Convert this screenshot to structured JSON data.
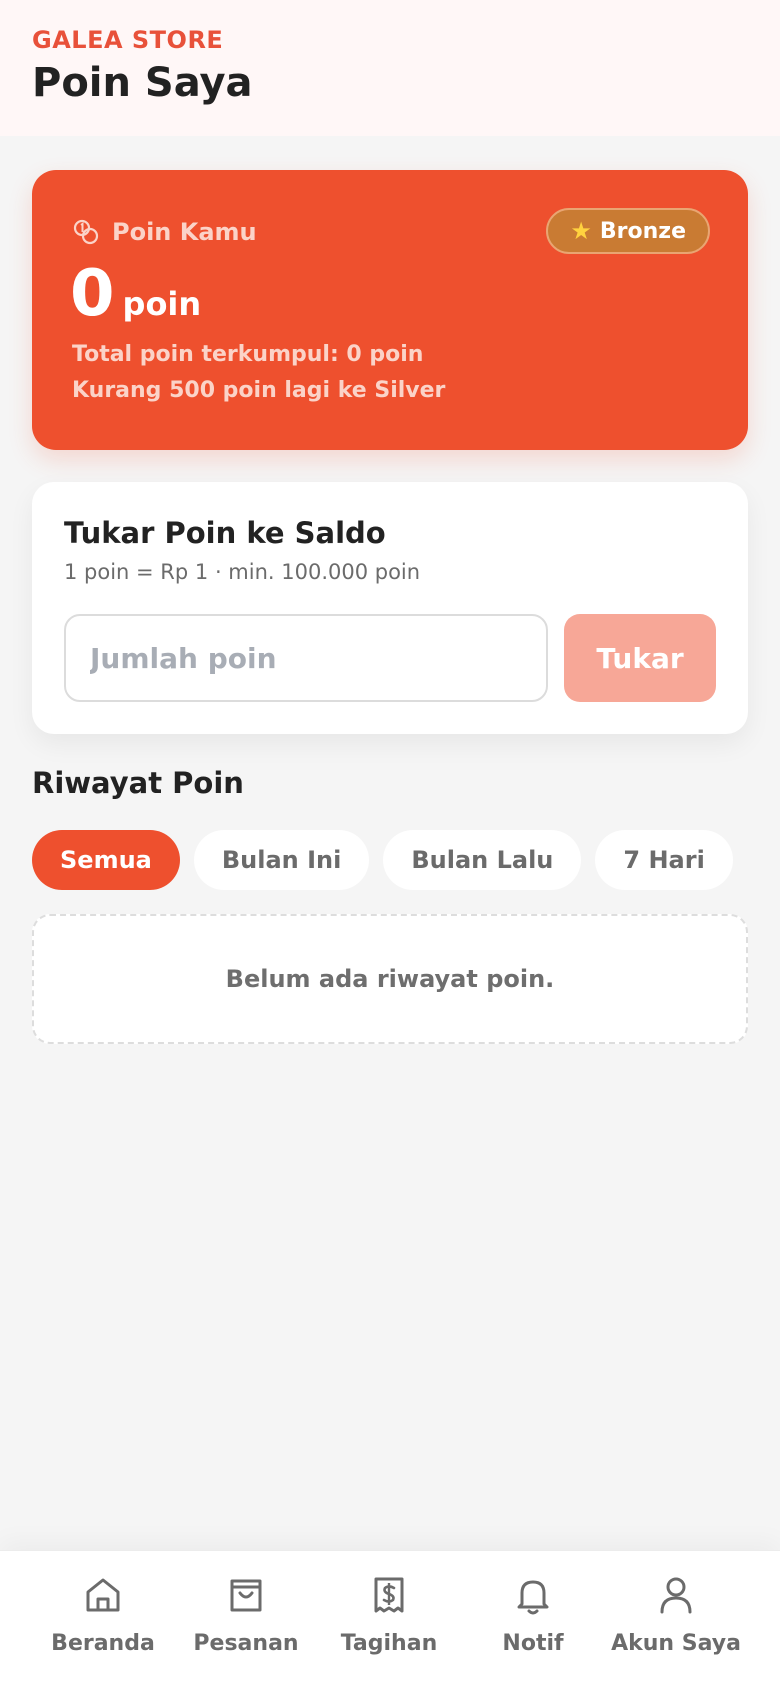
{
  "header": {
    "brand": "GALEA STORE",
    "title": "Poin Saya"
  },
  "points_card": {
    "label": "Poin Kamu",
    "tier": "Bronze",
    "tier_icon": "star-icon",
    "value": "0",
    "unit": "poin",
    "total_text": "Total poin terkumpul: 0 poin",
    "next_tier_text": "Kurang 500 poin lagi ke Silver"
  },
  "exchange": {
    "title": "Tukar Poin ke Saldo",
    "subtitle": "1 poin = Rp 1 · min. 100.000 poin",
    "input_placeholder": "Jumlah poin",
    "input_value": "",
    "button_label": "Tukar"
  },
  "history": {
    "title": "Riwayat Poin",
    "filters": [
      {
        "label": "Semua",
        "active": true
      },
      {
        "label": "Bulan Ini",
        "active": false
      },
      {
        "label": "Bulan Lalu",
        "active": false
      },
      {
        "label": "7 Hari",
        "active": false
      }
    ],
    "empty_text": "Belum ada riwayat poin."
  },
  "bottom_nav": {
    "items": [
      {
        "label": "Beranda",
        "icon": "home-icon"
      },
      {
        "label": "Pesanan",
        "icon": "shopping-bag-icon"
      },
      {
        "label": "Tagihan",
        "icon": "receipt-icon"
      },
      {
        "label": "Notif",
        "icon": "bell-icon"
      },
      {
        "label": "Akun Saya",
        "icon": "user-icon"
      }
    ]
  },
  "colors": {
    "accent": "#ee502e",
    "brand": "#e8513a",
    "tier_badge": "#c97b33",
    "button_disabled": "#f7a797"
  }
}
